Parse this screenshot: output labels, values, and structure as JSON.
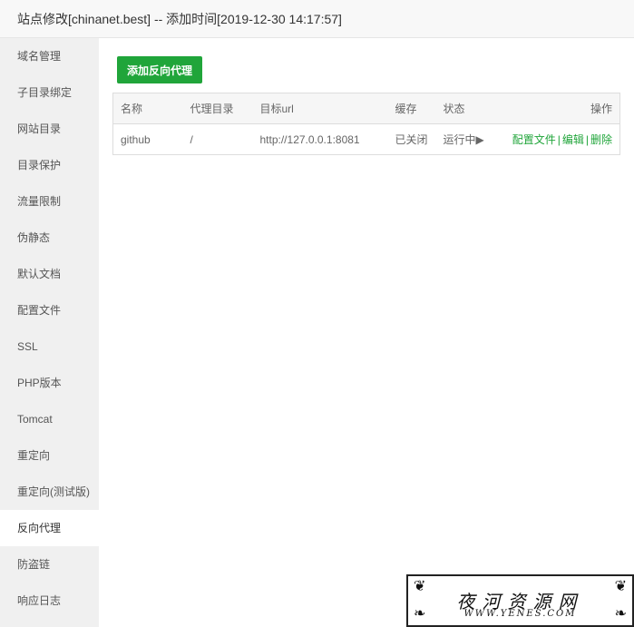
{
  "window": {
    "title": "站点修改[chinanet.best] -- 添加时间[2019-12-30 14:17:57]"
  },
  "sidebar": {
    "items": [
      {
        "label": "域名管理"
      },
      {
        "label": "子目录绑定"
      },
      {
        "label": "网站目录"
      },
      {
        "label": "目录保护"
      },
      {
        "label": "流量限制"
      },
      {
        "label": "伪静态"
      },
      {
        "label": "默认文档"
      },
      {
        "label": "配置文件"
      },
      {
        "label": "SSL"
      },
      {
        "label": "PHP版本"
      },
      {
        "label": "Tomcat"
      },
      {
        "label": "重定向"
      },
      {
        "label": "重定向(测试版)"
      },
      {
        "label": "反向代理",
        "active": true
      },
      {
        "label": "防盗链"
      },
      {
        "label": "响应日志"
      }
    ]
  },
  "toolbar": {
    "add_label": "添加反向代理"
  },
  "table": {
    "headers": {
      "name": "名称",
      "dir": "代理目录",
      "url": "目标url",
      "cache": "缓存",
      "status": "状态",
      "ops": "操作"
    },
    "rows": [
      {
        "name": "github",
        "dir": "/",
        "url": "http://127.0.0.1:8081",
        "cache": "已关闭",
        "status": "运行中▶",
        "op_config": "配置文件",
        "op_sep1": "|",
        "op_edit": "编辑",
        "op_sep2": "|",
        "op_delete": "删除"
      }
    ]
  },
  "watermark": {
    "cn": "夜河资源网",
    "en": "WWW.YENES.COM"
  },
  "colors": {
    "accent": "#20a53a",
    "danger": "#ef0808",
    "sidebar_bg": "#f0f0f0"
  }
}
